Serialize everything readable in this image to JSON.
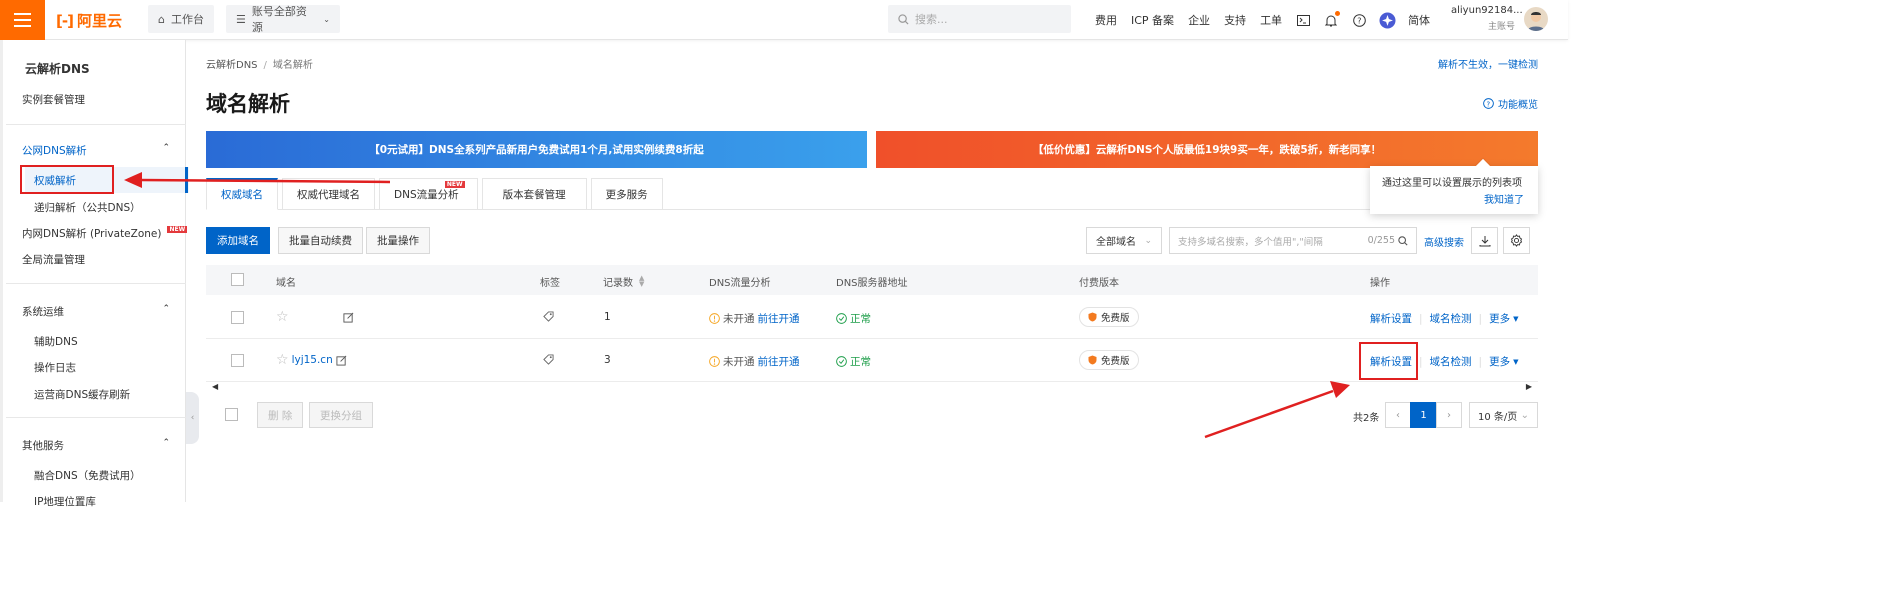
{
  "topbar": {
    "brand": "阿里云",
    "workbench": "工作台",
    "resources": "账号全部资源",
    "search_placeholder": "搜索...",
    "nav": [
      "费用",
      "ICP 备案",
      "企业",
      "支持",
      "工单"
    ],
    "lang": "简体",
    "user_name": "aliyun92184...",
    "user_role": "主账号"
  },
  "sidebar": {
    "title": "云解析DNS",
    "instance": "实例套餐管理",
    "public_dns": "公网DNS解析",
    "auth": "权威解析",
    "recursive": "递归解析（公共DNS）",
    "private_zone": "内网DNS解析 (PrivateZone)",
    "new_badge": "NEW",
    "gtm": "全局流量管理",
    "ops": "系统运维",
    "aux_dns": "辅助DNS",
    "oplog": "操作日志",
    "isp_cache": "运营商DNS缓存刷新",
    "other": "其他服务",
    "fusion": "融合DNS（免费试用）",
    "ip_geo": "IP地理位置库"
  },
  "main": {
    "breadcrumb": [
      "云解析DNS",
      "域名解析"
    ],
    "help_link": "解析不生效，一键检测",
    "title": "域名解析",
    "overview": "功能概览",
    "banner_left": "【0元试用】DNS全系列产品新用户免费试用1个月,试用实例续费8折起",
    "banner_right": "【低价优惠】云解析DNS个人版最低19块9买一年，跌破5折，新老同享！",
    "tabs": [
      "权威域名",
      "权威代理域名",
      "DNS流量分析",
      "版本套餐管理",
      "更多服务"
    ],
    "tab_new": "NEW",
    "tip_text": "通过这里可以设置展示的列表项",
    "tip_ok": "我知道了",
    "add_domain": "添加域名",
    "batch_renew": "批量自动续费",
    "batch_ops": "批量操作",
    "filter": "全部域名",
    "search_placeholder": "支持多域名搜索，多个值用\",\"间隔",
    "search_count": "0/255",
    "advanced": "高级搜索",
    "columns": [
      "域名",
      "标签",
      "记录数",
      "DNS流量分析",
      "DNS服务器地址",
      "付费版本",
      "操作"
    ],
    "rows": [
      {
        "domain": "",
        "records": "1",
        "traffic_status": "未开通",
        "traffic_link": "前往开通",
        "dns_status": "正常",
        "plan": "免费版",
        "action1": "解析设置",
        "action2": "域名检测",
        "action3": "更多"
      },
      {
        "domain": "lyj15.cn",
        "records": "3",
        "traffic_status": "未开通",
        "traffic_link": "前往开通",
        "dns_status": "正常",
        "plan": "免费版",
        "action1": "解析设置",
        "action2": "域名检测",
        "action3": "更多"
      }
    ],
    "delete": "删 除",
    "change_group": "更换分组",
    "total": "共2条",
    "current_page": "1",
    "page_size": "10 条/页"
  },
  "colors": {
    "accent": "#0064c8",
    "brand": "#ff6a00",
    "annotation": "#e02020"
  }
}
